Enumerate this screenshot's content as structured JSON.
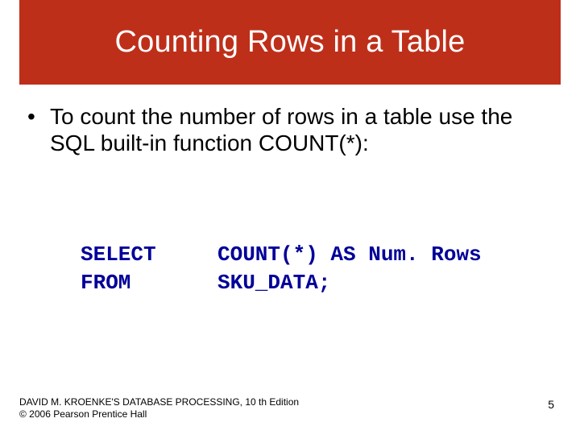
{
  "title": "Counting Rows in a Table",
  "bullet": {
    "mark": "•",
    "text": "To count the number of rows in a table use the SQL built-in function COUNT(*):"
  },
  "code": {
    "line1_kw": "SELECT",
    "line1_rest": "COUNT(*) AS Num. Rows",
    "line2_kw": "FROM",
    "line2_rest": "SKU_DATA;"
  },
  "footer": {
    "line1": "DAVID M. KROENKE'S DATABASE PROCESSING, 10 th Edition",
    "line2": "© 2006 Pearson Prentice Hall"
  },
  "page_number": "5"
}
